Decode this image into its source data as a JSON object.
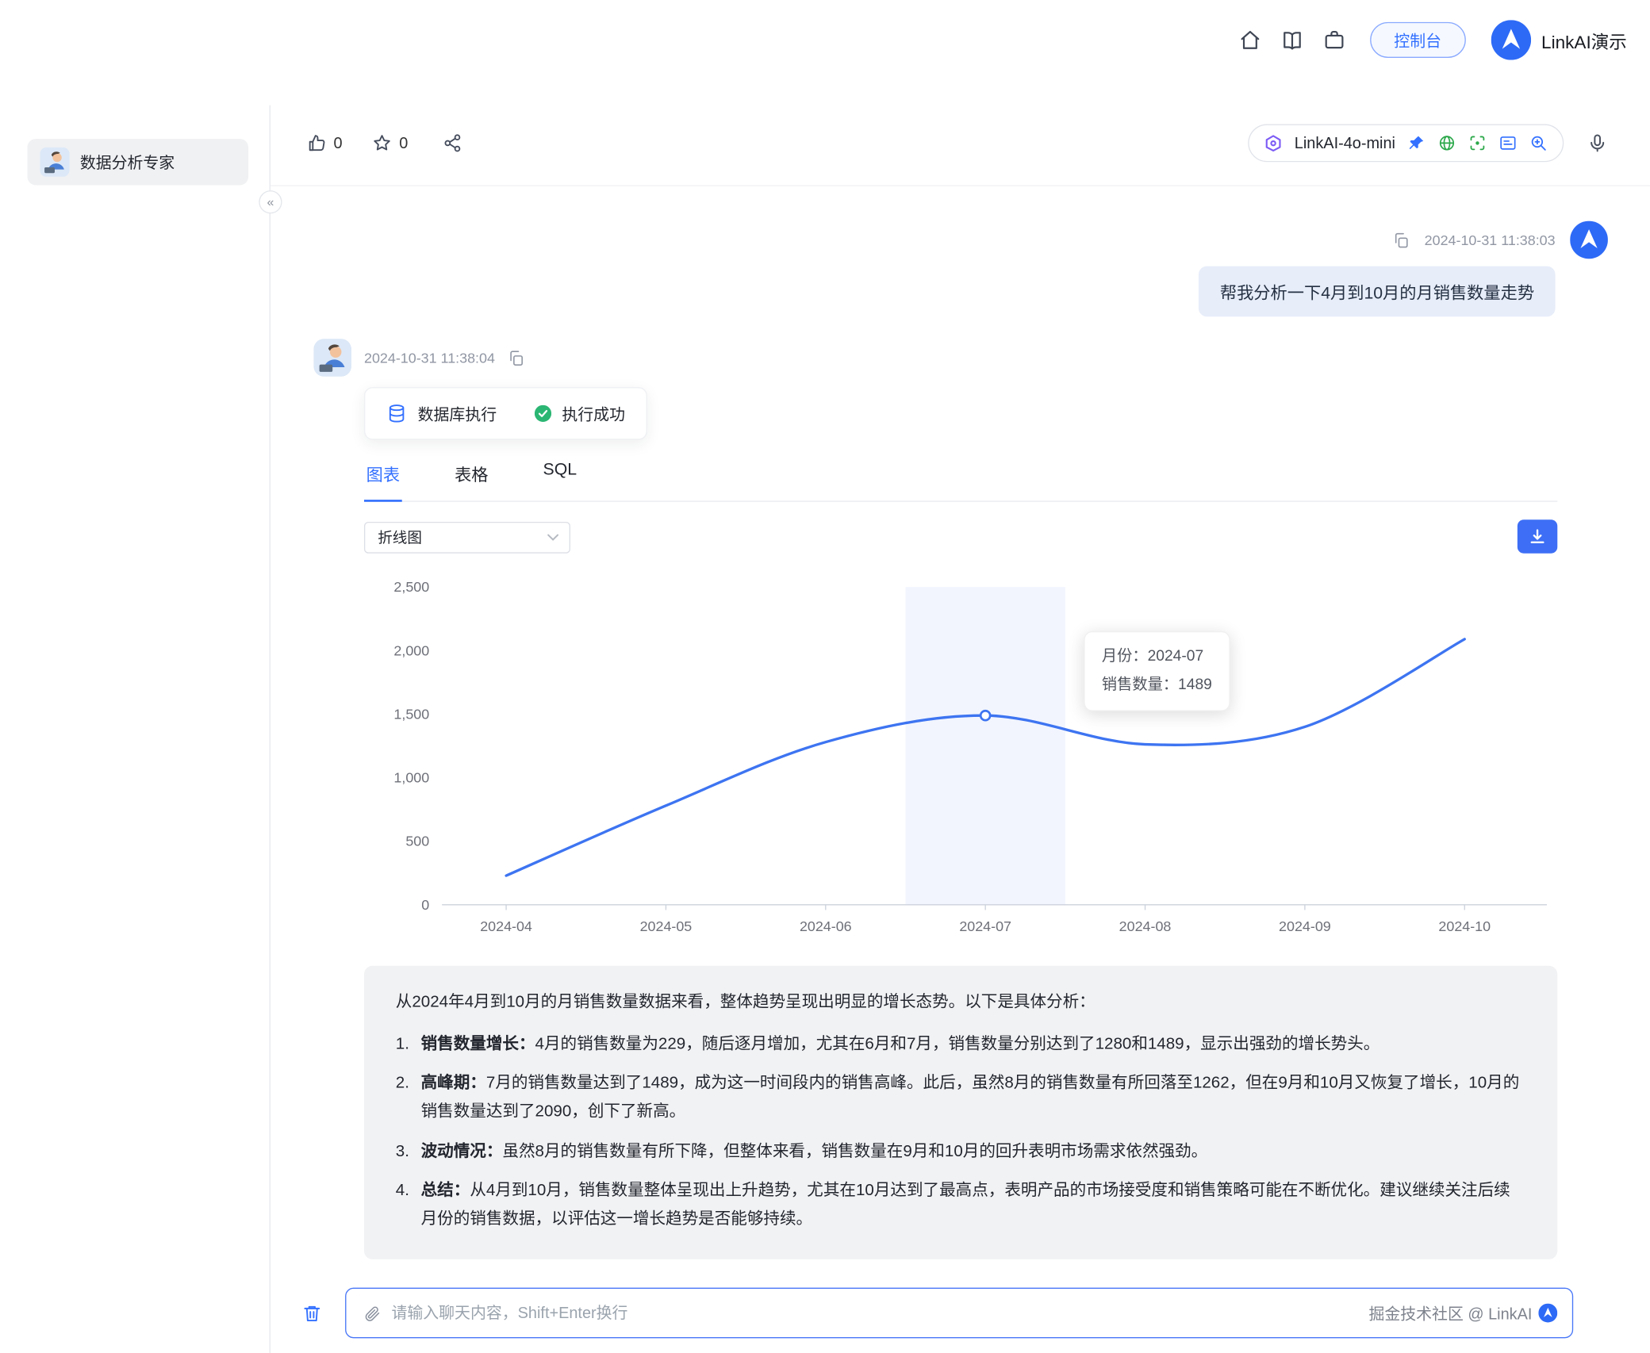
{
  "header": {
    "console_button": "控制台",
    "brand_name": "LinkAI演示"
  },
  "icons": {
    "collapse_glyph": "«"
  },
  "sidebar": {
    "agent": {
      "name": "数据分析专家"
    }
  },
  "toolbar": {
    "like_count": "0",
    "favorite_count": "0",
    "model_name": "LinkAI-4o-mini"
  },
  "chat": {
    "user_message": {
      "timestamp": "2024-10-31 11:38:03",
      "text": "帮我分析一下4月到10月的月销售数量走势"
    },
    "assistant_message": {
      "timestamp": "2024-10-31 11:38:04",
      "tool_card": {
        "title": "数据库执行",
        "status": "执行成功"
      },
      "tabs": [
        {
          "label": "图表"
        },
        {
          "label": "表格"
        },
        {
          "label": "SQL"
        }
      ],
      "chart_type": "折线图",
      "tooltip": {
        "line1": "月份：2024-07",
        "line2": "销售数量：1489"
      },
      "analysis": {
        "intro": "从2024年4月到10月的月销售数量数据来看，整体趋势呈现出明显的增长态势。以下是具体分析：",
        "items": [
          {
            "num": "1.",
            "label": "销售数量增长：",
            "text": "4月的销售数量为229，随后逐月增加，尤其在6月和7月，销售数量分别达到了1280和1489，显示出强劲的增长势头。"
          },
          {
            "num": "2.",
            "label": "高峰期：",
            "text": "7月的销售数量达到了1489，成为这一时间段内的销售高峰。此后，虽然8月的销售数量有所回落至1262，但在9月和10月又恢复了增长，10月的销售数量达到了2090，创下了新高。"
          },
          {
            "num": "3.",
            "label": "波动情况：",
            "text": "虽然8月的销售数量有所下降，但整体来看，销售数量在9月和10月的回升表明市场需求依然强劲。"
          },
          {
            "num": "4.",
            "label": "总结：",
            "text": "从4月到10月，销售数量整体呈现出上升趋势，尤其在10月达到了最高点，表明产品的市场接受度和销售策略可能在不断优化。建议继续关注后续月份的销售数据，以评估这一增长趋势是否能够持续。"
          }
        ]
      }
    }
  },
  "chart_data": {
    "type": "line",
    "title": "",
    "categories": [
      "2024-04",
      "2024-05",
      "2024-06",
      "2024-07",
      "2024-08",
      "2024-09",
      "2024-10"
    ],
    "values": [
      229,
      780,
      1280,
      1489,
      1262,
      1400,
      2090
    ],
    "series_name": "销售数量",
    "xlabel": "",
    "ylabel": "",
    "ylim": [
      0,
      2500
    ],
    "ytick_step": 500,
    "grid": false,
    "legend": "none",
    "highlight_index": 3,
    "marker_index": 3,
    "line_color": "#3d74f1",
    "highlight_color": "rgba(64,112,245,0.07)"
  },
  "composer": {
    "placeholder": "请输入聊天内容，Shift+Enter换行",
    "watermark": "掘金技术社区 @ LinkAI"
  }
}
